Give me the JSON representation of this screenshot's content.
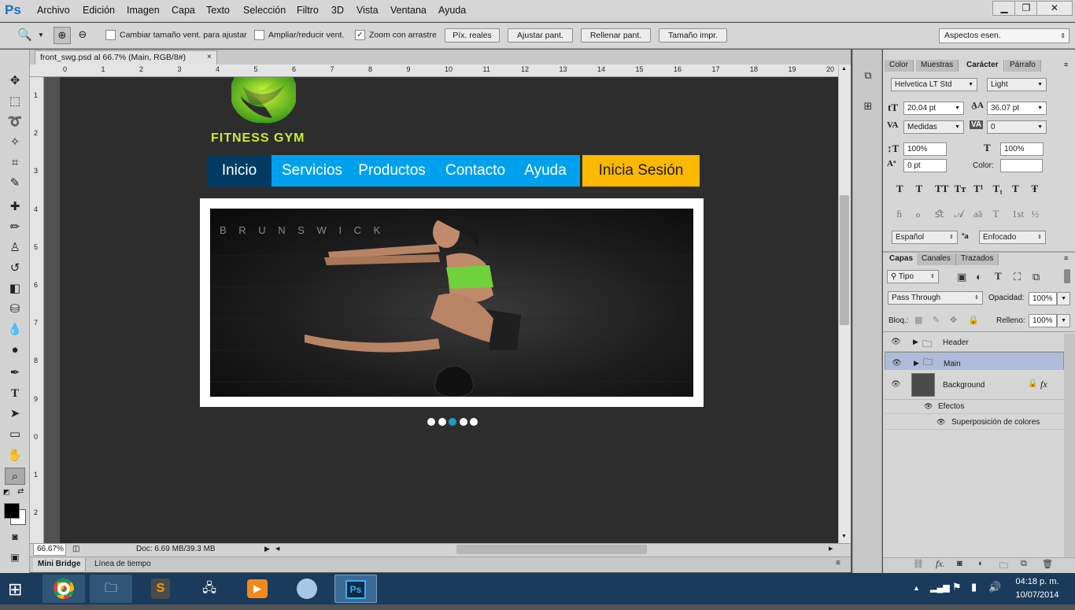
{
  "app": {
    "logo": "Ps"
  },
  "menu": [
    "Archivo",
    "Edición",
    "Imagen",
    "Capa",
    "Texto",
    "Selección",
    "Filtro",
    "3D",
    "Vista",
    "Ventana",
    "Ayuda"
  ],
  "window_controls": {
    "minimize": "▁",
    "restore": "❐",
    "close": "✕"
  },
  "options": {
    "chk_resize": "Cambiar tamaño vent. para ajustar",
    "chk_zoom_all": "Ampliar/reducir vent.",
    "chk_scrubby": "Zoom con arrastre",
    "btn_actual": "Píx. reales",
    "btn_fit": "Ajustar pant.",
    "btn_fill": "Rellenar pant.",
    "btn_print": "Tamaño impr.",
    "workspace": "Aspectos esen."
  },
  "document": {
    "tab_title": "front_swg.psd al 66.7% (Main, RGB/8#)",
    "tab_close": "×",
    "ruler_h": [
      "0",
      "1",
      "2",
      "3",
      "4",
      "5",
      "6",
      "7",
      "8",
      "9",
      "10",
      "11",
      "12",
      "13",
      "14",
      "15",
      "16",
      "17",
      "18",
      "19",
      "20"
    ],
    "ruler_v": [
      "1",
      "2",
      "3",
      "4",
      "5",
      "6",
      "7",
      "8",
      "9",
      "0",
      "1",
      "2"
    ]
  },
  "site": {
    "brand": "FITNESS GYM",
    "nav": [
      "Inicio",
      "Servicios",
      "Productos",
      "Contacto",
      "Ayuda"
    ],
    "login": "Inicia Sesión",
    "photo_text": "B R U N S W I C K",
    "slides": {
      "count": 5,
      "active_index": 2
    }
  },
  "status": {
    "zoom": "66.67%",
    "doc": "Doc: 6.69 MB/39.3 MB"
  },
  "bottom_tabs": [
    "Mini Bridge",
    "Línea de tiempo"
  ],
  "character_panel": {
    "tabs": [
      "Color",
      "Muestras",
      "Carácter",
      "Párrafo"
    ],
    "active_tab": "Carácter",
    "font_family": "Helvetica LT Std",
    "font_style": "Light",
    "font_size": "20.04 pt",
    "leading": "36.07 pt",
    "kerning": "Medidas",
    "tracking": "0",
    "vscale": "100%",
    "hscale": "100%",
    "baseline": "0 pt",
    "color_label": "Color:",
    "style_glyphs": [
      "T",
      "T",
      "TT",
      "Tт",
      "T¹",
      "T₁",
      "T",
      "Ŧ"
    ],
    "ot_glyphs": [
      "ﬁ",
      "ℴ",
      "ﬆ",
      "𝒜",
      "aā",
      "T",
      "1st",
      "½"
    ],
    "language": "Español",
    "antialias": "Enfocado"
  },
  "layers_panel": {
    "tabs": [
      "Capas",
      "Canales",
      "Trazados"
    ],
    "active_tab": "Capas",
    "filter": "Tipo",
    "blend": "Pass Through",
    "opacity_label": "Opacidad:",
    "opacity": "100%",
    "lock_label": "Bloq.:",
    "fill_label": "Relleno:",
    "fill": "100%",
    "layers": [
      {
        "name": "Header",
        "type": "group"
      },
      {
        "name": "Main",
        "type": "group",
        "selected": true
      },
      {
        "name": "Background",
        "type": "layer"
      }
    ],
    "effects_label": "Efectos",
    "effect_item": "Superposición de colores",
    "fx": "fx"
  },
  "taskbar": {
    "time": "04:18 p. m.",
    "date": "10/07/2014"
  },
  "colors": {
    "nav_blue": "#00a1ec",
    "nav_active": "#003b63",
    "login_yellow": "#fbb800",
    "dot_active": "#1c9ac8",
    "canvas": "#2d2d2d"
  }
}
